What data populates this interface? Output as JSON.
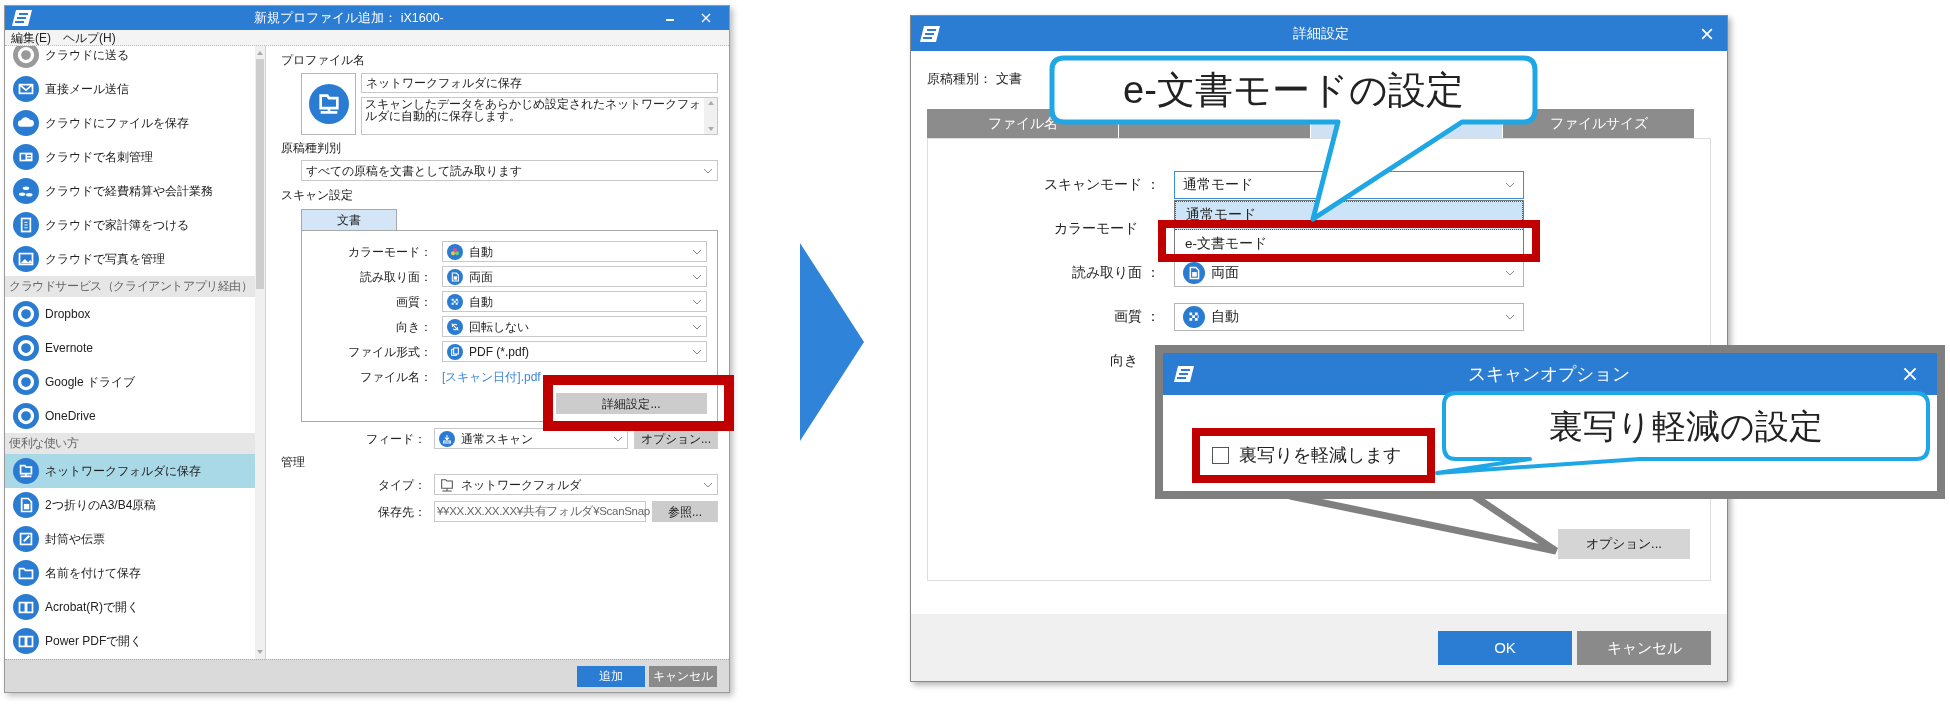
{
  "profile_window": {
    "title": "新規プロファイル追加： iX1600-",
    "menu": [
      "編集(E)",
      "ヘルプ(H)"
    ],
    "sidebar": [
      {
        "kind": "item",
        "label": "クラウドに送る",
        "selected": false
      },
      {
        "kind": "item",
        "label": "直接メール送信",
        "selected": false
      },
      {
        "kind": "item",
        "label": "クラウドにファイルを保存",
        "selected": false
      },
      {
        "kind": "item",
        "label": "クラウドで名刺管理",
        "selected": false
      },
      {
        "kind": "item",
        "label": "クラウドで経費精算や会計業務",
        "selected": false
      },
      {
        "kind": "item",
        "label": "クラウドで家計簿をつける",
        "selected": false
      },
      {
        "kind": "item",
        "label": "クラウドで写真を管理",
        "selected": false
      },
      {
        "kind": "header",
        "label": "クラウドサービス（クライアントアプリ経由）"
      },
      {
        "kind": "item",
        "label": "Dropbox",
        "selected": false
      },
      {
        "kind": "item",
        "label": "Evernote",
        "selected": false
      },
      {
        "kind": "item",
        "label": "Google ドライブ",
        "selected": false
      },
      {
        "kind": "item",
        "label": "OneDrive",
        "selected": false
      },
      {
        "kind": "header",
        "label": "便利な使い方"
      },
      {
        "kind": "item",
        "label": "ネットワークフォルダに保存",
        "selected": true
      },
      {
        "kind": "item",
        "label": "2つ折りのA3/B4原稿",
        "selected": false
      },
      {
        "kind": "item",
        "label": "封筒や伝票",
        "selected": false
      },
      {
        "kind": "item",
        "label": "名前を付けて保存",
        "selected": false
      },
      {
        "kind": "item",
        "label": "Acrobat(R)で開く",
        "selected": false
      },
      {
        "kind": "item",
        "label": "Power PDFで開く",
        "selected": false
      }
    ],
    "profile_name_label": "プロファイル名",
    "profile_name": "ネットワークフォルダに保存",
    "description": "スキャンしたデータをあらかじめ設定されたネットワークフォルダに自動的に保存します。",
    "doc_type_label": "原稿種判別",
    "doc_type": "すべての原稿を文書として読み取ります",
    "scan_settings_label": "スキャン設定",
    "scan_tabs": [
      {
        "label": "文書",
        "selected": true
      }
    ],
    "settings": [
      {
        "label": "カラーモード：",
        "value": "自動"
      },
      {
        "label": "読み取り面：",
        "value": "両面"
      },
      {
        "label": "画質：",
        "value": "自動"
      },
      {
        "label": "向き：",
        "value": "回転しない"
      },
      {
        "label": "ファイル形式：",
        "value": "PDF (*.pdf)"
      }
    ],
    "file_name": {
      "label": "ファイル名：",
      "value": "[スキャン日付].pdf"
    },
    "detail_button": "詳細設定...",
    "feed": {
      "label": "フィード：",
      "value": "通常スキャン",
      "button": "オプション..."
    },
    "management_label": "管理",
    "type": {
      "label": "タイプ：",
      "value": "ネットワークフォルダ"
    },
    "destination": {
      "label": "保存先：",
      "value": "¥¥XX.XX.XX.XX¥共有フォルダ¥ScanSnap",
      "button": "参照..."
    },
    "buttons": [
      {
        "label": "追加",
        "kind": "primary"
      },
      {
        "label": "キャンセル",
        "kind": "secondary"
      }
    ]
  },
  "detail_window": {
    "title": "詳細設定",
    "doc_type": "原稿種別： 文書",
    "tabs": [
      {
        "label": "ファイル名",
        "selected": false
      },
      {
        "selected": false
      },
      {
        "selected": true
      },
      {
        "label": "ファイルサイズ",
        "selected": false
      }
    ],
    "rows": [
      {
        "kind": "combo",
        "label": "スキャンモード ：",
        "value": "通常モード",
        "options": [
          {
            "label": "通常モード",
            "selected": true
          },
          {
            "label": "e-文書モード",
            "selected": false
          }
        ]
      },
      {
        "kind": "label",
        "label": "カラーモード"
      },
      {
        "kind": "combo",
        "label": "読み取り面 ：",
        "value": "両面"
      },
      {
        "kind": "combo",
        "label": "画質 ：",
        "value": "自動"
      },
      {
        "kind": "label",
        "label": "向き"
      }
    ],
    "option_button": "オプション...",
    "buttons": [
      {
        "label": "OK",
        "kind": "primary"
      },
      {
        "label": "キャンセル",
        "kind": "secondary"
      }
    ]
  },
  "option_dialog": {
    "title": "スキャンオプション",
    "checkbox": {
      "label": "裏写りを軽減します",
      "checked": false
    }
  },
  "callouts": [
    {
      "text": "e-文書モードの設定"
    },
    {
      "text": "裏写り軽減の設定"
    }
  ]
}
